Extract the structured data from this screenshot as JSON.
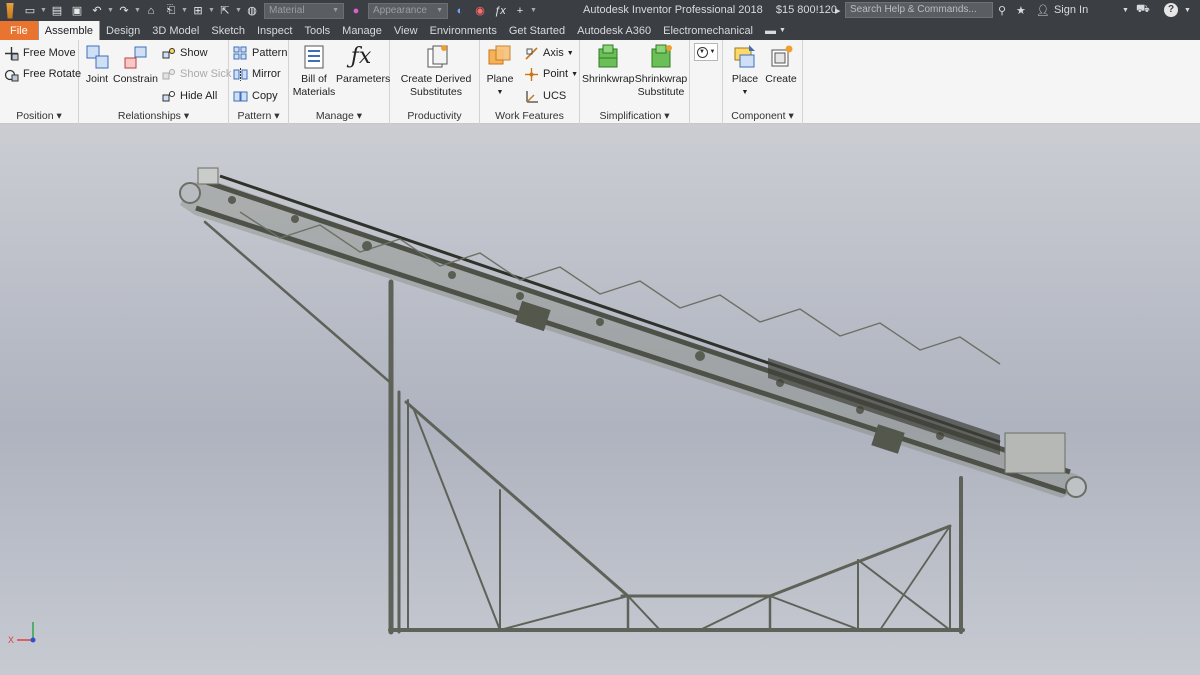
{
  "window": {
    "app_title": "Autodesk Inventor Professional 2018",
    "doc_title": "$15 800!120",
    "search_placeholder": "Search Help & Commands...",
    "sign_in": "Sign In",
    "combo_material": "Material",
    "combo_appearance": "Appearance"
  },
  "tabs": [
    {
      "label": "File"
    },
    {
      "label": "Assemble"
    },
    {
      "label": "Design"
    },
    {
      "label": "3D Model"
    },
    {
      "label": "Sketch"
    },
    {
      "label": "Inspect"
    },
    {
      "label": "Tools"
    },
    {
      "label": "Manage"
    },
    {
      "label": "View"
    },
    {
      "label": "Environments"
    },
    {
      "label": "Get Started"
    },
    {
      "label": "Autodesk A360"
    },
    {
      "label": "Electromechanical"
    }
  ],
  "ribbon": {
    "position": {
      "label": "Position",
      "free_move": "Free Move",
      "free_rotate": "Free Rotate"
    },
    "relationships": {
      "label": "Relationships",
      "joint": "Joint",
      "constrain": "Constrain",
      "show": "Show",
      "show_sick": "Show Sick",
      "hide_all": "Hide All"
    },
    "pattern": {
      "label": "Pattern",
      "pattern": "Pattern",
      "mirror": "Mirror",
      "copy": "Copy"
    },
    "manage": {
      "label": "Manage",
      "bom_line1": "Bill of",
      "bom_line2": "Materials",
      "parameters": "Parameters"
    },
    "productivity": {
      "label": "Productivity",
      "cds_line1": "Create Derived",
      "cds_line2": "Substitutes"
    },
    "work_features": {
      "label": "Work Features",
      "plane": "Plane",
      "axis": "Axis",
      "point": "Point",
      "ucs": "UCS"
    },
    "simplification": {
      "label": "Simplification",
      "shrinkwrap": "Shrinkwrap",
      "sws_line1": "Shrinkwrap",
      "sws_line2": "Substitute"
    },
    "component": {
      "label": "Component",
      "place": "Place",
      "create": "Create"
    }
  },
  "viewcube": {
    "x_label": "X"
  },
  "colors": {
    "accent_file": "#e8742f",
    "titlebar": "#3b3f44",
    "ribbon": "#f5f5f5"
  }
}
